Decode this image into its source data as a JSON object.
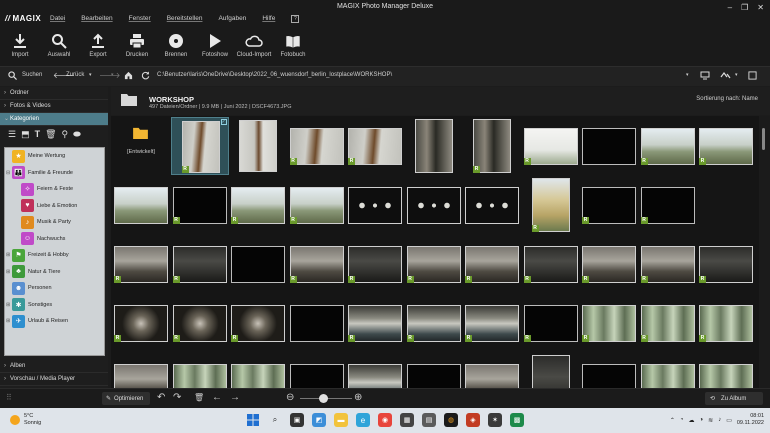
{
  "app": {
    "title": "MAGIX Photo Manager Deluxe",
    "logo": "MAGIX",
    "menu": [
      "Datei",
      "Bearbeiten",
      "Fenster",
      "Bereitstellen",
      "Aufgaben",
      "Hilfe"
    ]
  },
  "toolbar": {
    "buttons": [
      "Import",
      "Auswahl",
      "Export",
      "Drucken",
      "Brennen",
      "Fotoshow",
      "Cloud-Import",
      "Fotobuch"
    ]
  },
  "pathbar": {
    "search": "Suchen",
    "back": "Zurück",
    "path": "C:\\Benutzer\\laris\\OneDrive\\Desktop\\2022_06_wuensdorf_berlin_lostplace\\WORKSHOP\\"
  },
  "sidebar": {
    "sections_top": [
      "Ordner",
      "Fotos & Videos"
    ],
    "active_section": "Kategorien",
    "categories": [
      {
        "label": "Meine Wertung",
        "color": "#f0b323",
        "icon": "star-icon",
        "indent": 0
      },
      {
        "label": "Familie & Freunde",
        "color": "#c04ac8",
        "icon": "people-icon",
        "indent": 0
      },
      {
        "label": "Feiern & Feste",
        "color": "#c04ac8",
        "icon": "party-icon",
        "indent": 1
      },
      {
        "label": "Liebe & Emotion",
        "color": "#c0305a",
        "icon": "heart-icon",
        "indent": 1
      },
      {
        "label": "Musik & Party",
        "color": "#e08a1e",
        "icon": "music-icon",
        "indent": 1
      },
      {
        "label": "Nachwuchs",
        "color": "#c04ac8",
        "icon": "baby-icon",
        "indent": 1
      },
      {
        "label": "Freizeit & Hobby",
        "color": "#4aa53a",
        "icon": "leisure-icon",
        "indent": 0
      },
      {
        "label": "Natur & Tiere",
        "color": "#3e9a3b",
        "icon": "tree-icon",
        "indent": 0
      },
      {
        "label": "Personen",
        "color": "#5a8fd0",
        "icon": "person-icon",
        "indent": 0
      },
      {
        "label": "Sonstiges",
        "color": "#3a9a9a",
        "icon": "misc-icon",
        "indent": 0
      },
      {
        "label": "Urlaub & Reisen",
        "color": "#2e8fcf",
        "icon": "travel-icon",
        "indent": 0
      }
    ],
    "sections_bottom": [
      "Alben",
      "Vorschau / Media Player"
    ]
  },
  "content": {
    "folder_name": "WORKSHOP",
    "info": "497 Dateien/Ordner | 9.9 MB | Juni 2022 | DSCF4673.JPG",
    "sort_label": "Sortierung nach: Name",
    "developed_folder": "[Entwickelt]",
    "raw_badge": "R"
  },
  "bottombar": {
    "optimize": "Optimieren",
    "to_album": "Zu Album",
    "zoom_level": 0.45
  },
  "taskbar": {
    "temperature": "5°C",
    "weather": "Sonnig",
    "time": "08:01",
    "date": "09.11.2022"
  }
}
